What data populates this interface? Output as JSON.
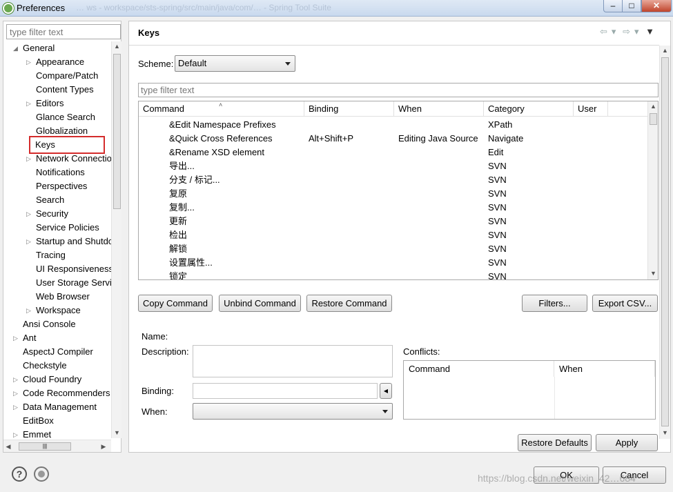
{
  "window": {
    "title": "Preferences",
    "ghost_title": "… ws - workspace/sts-spring/src/main/java/com/… - Spring Tool Suite",
    "controls": [
      "minimize",
      "maximize",
      "close"
    ]
  },
  "sidebar": {
    "filter_placeholder": "type filter text",
    "tree": [
      {
        "label": "General",
        "level": 0,
        "toggle": "expanded"
      },
      {
        "label": "Appearance",
        "level": 1,
        "toggle": "collapsed"
      },
      {
        "label": "Compare/Patch",
        "level": 1,
        "toggle": "none"
      },
      {
        "label": "Content Types",
        "level": 1,
        "toggle": "none"
      },
      {
        "label": "Editors",
        "level": 1,
        "toggle": "collapsed"
      },
      {
        "label": "Glance Search",
        "level": 1,
        "toggle": "none"
      },
      {
        "label": "Globalization",
        "level": 1,
        "toggle": "none"
      },
      {
        "label": "Keys",
        "level": 1,
        "toggle": "none",
        "selected": true
      },
      {
        "label": "Network Connections",
        "level": 1,
        "toggle": "collapsed"
      },
      {
        "label": "Notifications",
        "level": 1,
        "toggle": "none"
      },
      {
        "label": "Perspectives",
        "level": 1,
        "toggle": "none"
      },
      {
        "label": "Search",
        "level": 1,
        "toggle": "none"
      },
      {
        "label": "Security",
        "level": 1,
        "toggle": "collapsed"
      },
      {
        "label": "Service Policies",
        "level": 1,
        "toggle": "none"
      },
      {
        "label": "Startup and Shutdown",
        "level": 1,
        "toggle": "collapsed"
      },
      {
        "label": "Tracing",
        "level": 1,
        "toggle": "none"
      },
      {
        "label": "UI Responsiveness",
        "level": 1,
        "toggle": "none"
      },
      {
        "label": "User Storage Service",
        "level": 1,
        "toggle": "none"
      },
      {
        "label": "Web Browser",
        "level": 1,
        "toggle": "none"
      },
      {
        "label": "Workspace",
        "level": 1,
        "toggle": "collapsed"
      },
      {
        "label": "Ansi Console",
        "level": 0,
        "toggle": "none"
      },
      {
        "label": "Ant",
        "level": 0,
        "toggle": "collapsed"
      },
      {
        "label": "AspectJ Compiler",
        "level": 0,
        "toggle": "none"
      },
      {
        "label": "Checkstyle",
        "level": 0,
        "toggle": "none"
      },
      {
        "label": "Cloud Foundry",
        "level": 0,
        "toggle": "collapsed"
      },
      {
        "label": "Code Recommenders",
        "level": 0,
        "toggle": "collapsed"
      },
      {
        "label": "Data Management",
        "level": 0,
        "toggle": "collapsed"
      },
      {
        "label": "EditBox",
        "level": 0,
        "toggle": "none"
      },
      {
        "label": "Emmet",
        "level": 0,
        "toggle": "collapsed"
      }
    ]
  },
  "page": {
    "title": "Keys",
    "scheme_label": "Scheme:",
    "scheme_value": "Default",
    "filter_placeholder": "type filter text",
    "table": {
      "columns": [
        "Command",
        "Binding",
        "When",
        "Category",
        "User"
      ],
      "rows": [
        {
          "command": "&Edit Namespace Prefixes",
          "binding": "",
          "when": "",
          "category": "XPath",
          "user": ""
        },
        {
          "command": "&Quick Cross References",
          "binding": "Alt+Shift+P",
          "when": "Editing Java Source",
          "category": "Navigate",
          "user": ""
        },
        {
          "command": "&Rename XSD element",
          "binding": "",
          "when": "",
          "category": "Edit",
          "user": ""
        },
        {
          "command": "导出...",
          "binding": "",
          "when": "",
          "category": "SVN",
          "user": ""
        },
        {
          "command": "分支 / 标记...",
          "binding": "",
          "when": "",
          "category": "SVN",
          "user": ""
        },
        {
          "command": "复原",
          "binding": "",
          "when": "",
          "category": "SVN",
          "user": ""
        },
        {
          "command": "复制...",
          "binding": "",
          "when": "",
          "category": "SVN",
          "user": ""
        },
        {
          "command": "更新",
          "binding": "",
          "when": "",
          "category": "SVN",
          "user": ""
        },
        {
          "command": "检出",
          "binding": "",
          "when": "",
          "category": "SVN",
          "user": ""
        },
        {
          "command": "解锁",
          "binding": "",
          "when": "",
          "category": "SVN",
          "user": ""
        },
        {
          "command": "设置属性...",
          "binding": "",
          "when": "",
          "category": "SVN",
          "user": ""
        },
        {
          "command": "锁定",
          "binding": "",
          "when": "",
          "category": "SVN",
          "user": ""
        }
      ]
    },
    "buttons": {
      "copy": "Copy Command",
      "unbind": "Unbind Command",
      "restore": "Restore Command",
      "filters": "Filters...",
      "export": "Export CSV..."
    },
    "details": {
      "name_label": "Name:",
      "description_label": "Description:",
      "binding_label": "Binding:",
      "when_label": "When:",
      "conflicts_label": "Conflicts:",
      "conflict_columns": [
        "Command",
        "When"
      ]
    },
    "restore_defaults": "Restore Defaults",
    "apply": "Apply"
  },
  "footer": {
    "ok": "OK",
    "cancel": "Cancel",
    "watermark": "https://blog.csdn.net/weixin_42…684"
  }
}
